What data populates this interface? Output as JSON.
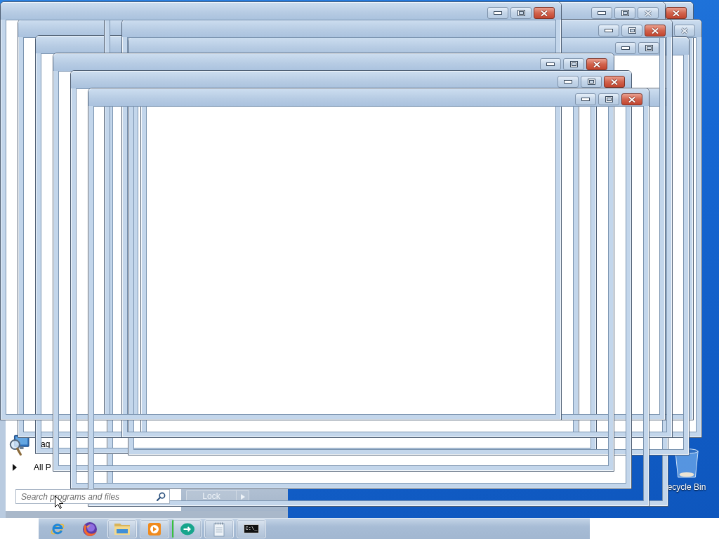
{
  "windows": [
    {
      "buttons": [
        {
          "kind": "close",
          "active": true
        }
      ]
    },
    {
      "buttons": [
        {
          "kind": "close",
          "active": false
        }
      ]
    },
    {
      "buttons": [
        {
          "kind": "minimize"
        },
        {
          "kind": "maximize"
        }
      ]
    },
    {
      "buttons": [
        {
          "kind": "minimize"
        },
        {
          "kind": "maximize"
        },
        {
          "kind": "close",
          "active": false
        }
      ]
    },
    {
      "buttons": [
        {
          "kind": "minimize"
        },
        {
          "kind": "maximize"
        },
        {
          "kind": "close",
          "active": true
        }
      ]
    },
    {
      "buttons": [
        {
          "kind": "minimize"
        },
        {
          "kind": "maximize"
        },
        {
          "kind": "close",
          "active": true
        }
      ]
    },
    {
      "buttons": [
        {
          "kind": "minimize"
        },
        {
          "kind": "maximize"
        },
        {
          "kind": "close",
          "active": true
        }
      ]
    },
    {
      "buttons": [
        {
          "kind": "minimize"
        },
        {
          "kind": "maximize"
        },
        {
          "kind": "close",
          "active": true
        }
      ]
    },
    {
      "buttons": [
        {
          "kind": "minimize"
        },
        {
          "kind": "maximize"
        },
        {
          "kind": "close",
          "active": true
        }
      ]
    }
  ],
  "start_menu": {
    "programs": [
      {
        "kind": "magnifier",
        "label": "ag"
      }
    ],
    "all_programs": {
      "label": "All P"
    },
    "search": {
      "placeholder": "Search programs and files"
    },
    "power_button": {
      "label": "Lock"
    }
  },
  "desktop_icons": [
    {
      "kind": "recycle-bin",
      "label": "ecycle Bin"
    }
  ],
  "taskbar": {
    "items": [
      {
        "kind": "e-browser",
        "running": false,
        "highlighted": false
      },
      {
        "kind": "fox-browser",
        "running": false,
        "highlighted": false
      },
      {
        "kind": "folder",
        "running": true,
        "highlighted": false
      },
      {
        "kind": "media",
        "running": true,
        "highlighted": false
      },
      {
        "kind": "chat",
        "running": true,
        "highlighted": true
      },
      {
        "kind": "notepad",
        "running": true,
        "highlighted": false
      },
      {
        "kind": "terminal",
        "running": true,
        "highlighted": false,
        "glyph": "C:\\_"
      }
    ]
  }
}
